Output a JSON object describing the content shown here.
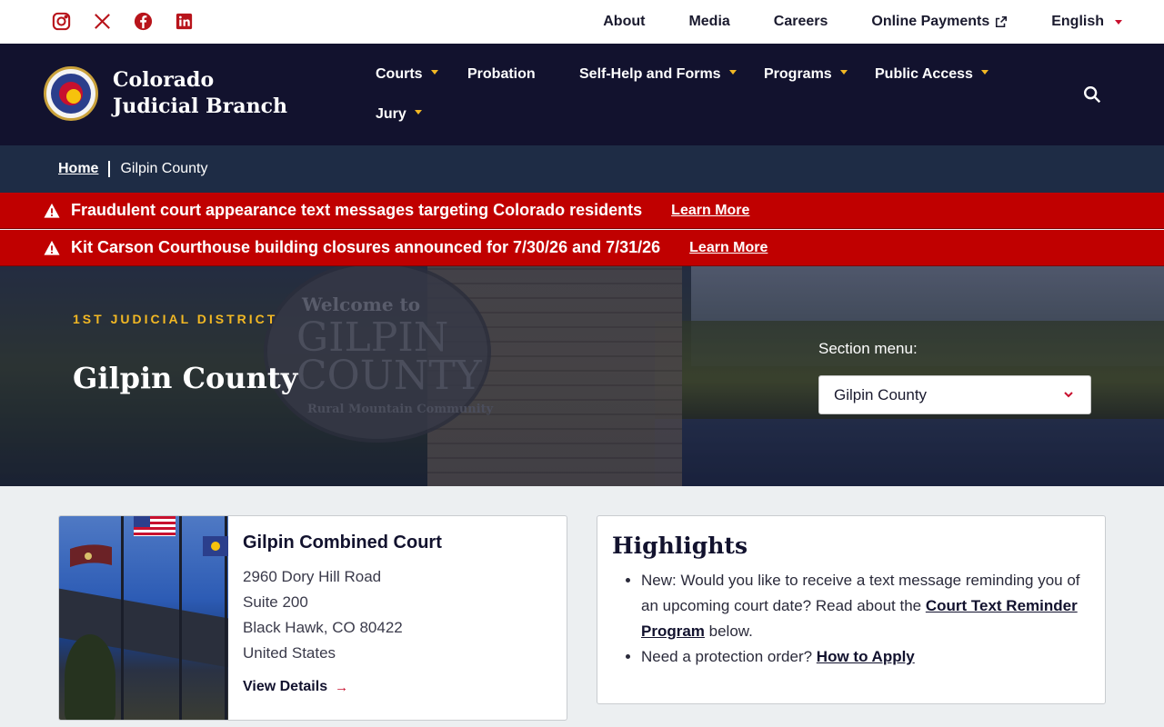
{
  "utility": {
    "social": [
      {
        "name": "instagram-icon"
      },
      {
        "name": "x-twitter-icon"
      },
      {
        "name": "facebook-icon"
      },
      {
        "name": "linkedin-icon"
      }
    ],
    "links": {
      "about": "About",
      "media": "Media",
      "careers": "Careers",
      "payments": "Online Payments",
      "language": "English"
    }
  },
  "header": {
    "brand": "Colorado Judicial Branch",
    "menu": {
      "courts": "Courts",
      "probation": "Probation",
      "selfhelp": "Self-Help and Forms",
      "programs": "Programs",
      "public_access": "Public Access",
      "jury": "Jury"
    }
  },
  "breadcrumb": {
    "home": "Home",
    "current": "Gilpin County"
  },
  "alerts": [
    {
      "message": "Fraudulent court appearance text messages targeting Colorado residents",
      "link": "Learn More"
    },
    {
      "message": "Kit Carson Courthouse building closures announced for 7/30/26 and 7/31/26",
      "link": "Learn More"
    }
  ],
  "hero": {
    "eyebrow": "1ST JUDICIAL DISTRICT",
    "title": "Gilpin County",
    "section_label": "Section menu:",
    "section_value": "Gilpin County",
    "sign_line1": "Welcome to",
    "sign_line2": "GILPIN COUNTY",
    "sign_line3": "Rural Mountain Community"
  },
  "court": {
    "name": "Gilpin Combined Court",
    "address_line1": "2960 Dory Hill Road",
    "address_line2": "Suite 200",
    "address_line3": "Black Hawk, CO 80422",
    "address_line4": "United States",
    "link": "View Details"
  },
  "highlights": {
    "title": "Highlights",
    "item1_text": "New: Would you like to receive a text message reminding you of an upcoming court date? Read about the ",
    "item1_link": "Court Text Reminder Program",
    "item1_after": " below.",
    "item2_text": "Need a protection order? ",
    "item2_link": "How to Apply"
  },
  "colors": {
    "navy": "#12122e",
    "alert_red": "#c00000",
    "gold": "#f2b824",
    "brand_red": "#b8141b"
  }
}
